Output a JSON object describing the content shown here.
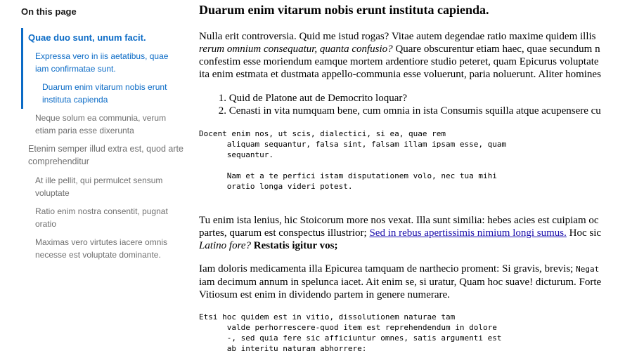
{
  "toc": {
    "title": "On this page",
    "items": [
      {
        "label_lines": [
          "Quae duo sunt, unum facit."
        ]
      },
      {
        "label_lines": [
          "Expressa vero in iis aetatibus, quae",
          "iam confirmatae sunt."
        ]
      },
      {
        "label_lines": [
          "Duarum enim vitarum nobis erunt",
          "instituta capienda"
        ]
      },
      {
        "label_lines": [
          "Neque solum ea communia, verum",
          "etiam paria esse dixerunta"
        ]
      },
      {
        "label_lines": [
          "Etenim semper illud extra est, quod arte",
          "comprehenditur"
        ]
      },
      {
        "label_lines": [
          "At ille pellit, qui permulcet sensum",
          "voluptate"
        ]
      },
      {
        "label_lines": [
          "Ratio enim nostra consentit, pugnat",
          "oratio"
        ]
      },
      {
        "label_lines": [
          "Maximas vero virtutes iacere omnis",
          "necesse est voluptate dominante."
        ]
      }
    ]
  },
  "main": {
    "heading": "Duarum enim vitarum nobis erunt instituta capienda.",
    "p1": {
      "l1": "Nulla erit controversia. Quid me istud rogas? Vitae autem degendae ratio maxime quidem illis",
      "l2_em": "rerum omnium consequatur, quanta confusio?",
      "l2_rest": " Quare obscurentur etiam haec, quae secundum n",
      "l3": "confestim esse moriendum eamque mortem ardentiore studio peteret, quam Epicurus voluptate",
      "l4": "ita enim estmata et dustmata appello-communia esse voluerunt, paria noluerunt. Aliter homines"
    },
    "list": [
      {
        "num": "1.",
        "text": "Quid de Platone aut de Democrito loquar?"
      },
      {
        "num": "2.",
        "text": "Cenasti in vita numquam bene, cum omnia in ista Consumis squilla atque acupensere cu"
      }
    ],
    "code1": "Docent enim nos, ut scis, dialectici, si ea, quae rem\n      aliquam sequantur, falsa sint, falsam illam ipsam esse, quam\n      sequantur.\n\n      Nam et a te perfici istam disputationem volo, nec tua mihi\n      oratio longa videri potest.",
    "p2": {
      "l1": "Tu enim ista lenius, hic Stoicorum more nos vexat. Illa sunt similia: hebes acies est cuipiam oc",
      "l2_a": "partes, quarum est conspectus illustrior; ",
      "l2_link": "Sed in rebus apertissimis nimium longi sumus.",
      "l2_b": " Hoc sic",
      "l3_em": "Latino fore?",
      "l3_strong": "Restatis igitur vos;"
    },
    "p3": {
      "l1_a": "Iam doloris medicamenta illa Epicurea tamquam de narthecio proment: Si gravis, brevis; ",
      "l1_mono": "Negat",
      "l2": "iam decimum annum in spelunca iacet. Ait enim se, si uratur, Quam hoc suave! dicturum. Forte",
      "l3": "Vitiosum est enim in dividendo partem in genere numerare."
    },
    "code2": "Etsi hoc quidem est in vitio, dissolutionem naturae tam\n      valde perhorrescere-quod item est reprehendendum in dolore\n      -, sed quia fere sic afficiuntur omnes, satis argumenti est\n      ab interitu naturam abhorrere;"
  }
}
